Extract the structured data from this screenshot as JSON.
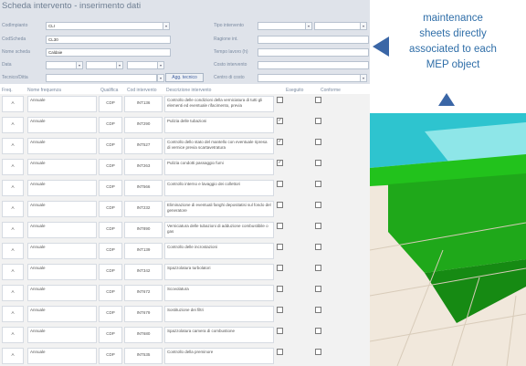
{
  "form": {
    "title": "Scheda intervento - inserimento dati",
    "fields_left": [
      {
        "label": "CodImpianto",
        "value": "CLI"
      },
      {
        "label": "CodScheda",
        "value": "CL30"
      },
      {
        "label": "Nome scheda",
        "value": "Caldaie"
      },
      {
        "label": "Data",
        "value": ""
      },
      {
        "label": "Tecnico/Ditta",
        "value": ""
      }
    ],
    "fields_right": [
      {
        "label": "Tipo intervento",
        "value": ""
      },
      {
        "label": "Ragione int.",
        "value": ""
      },
      {
        "label": "Tempo lavoro (h)",
        "value": ""
      },
      {
        "label": "Costo intervento",
        "value": ""
      },
      {
        "label": "Centro di costo",
        "value": ""
      }
    ],
    "agg_button": "Agg. tecnico",
    "columns": [
      "Freq.",
      "Nome frequenza",
      "Qualifica",
      "Cod intervento",
      "Descrizione intervento",
      "Eseguito",
      "Conforme"
    ],
    "rows": [
      {
        "freq": "A",
        "name": "Annuale",
        "qual": "CDP",
        "code": "INT136",
        "desc": "Controllo delle condizioni della verniciatura di tutti gli elementi ed eventuale rifacimento, previa",
        "done": false,
        "conf": false
      },
      {
        "freq": "A",
        "name": "Annuale",
        "qual": "CDP",
        "code": "INT290",
        "desc": "Pulizia delle tubazioni",
        "done": true,
        "conf": false
      },
      {
        "freq": "A",
        "name": "Annuale",
        "qual": "CDP",
        "code": "INT527",
        "desc": "Controllo dello stato del mantello con eventuale ripresa di vernice previa scartavetratura",
        "done": true,
        "conf": false
      },
      {
        "freq": "A",
        "name": "Annuale",
        "qual": "CDP",
        "code": "INT263",
        "desc": "Pulizia condotti passaggio fumi",
        "done": true,
        "conf": false
      },
      {
        "freq": "A",
        "name": "Annuale",
        "qual": "CDP",
        "code": "INT566",
        "desc": "Controllo interno e lavaggio dei collettori",
        "done": false,
        "conf": false
      },
      {
        "freq": "A",
        "name": "Annuale",
        "qual": "CDP",
        "code": "INT232",
        "desc": "Eliminazione di eventuali fanghi depositatisi sul fondo del generatore",
        "done": false,
        "conf": false
      },
      {
        "freq": "A",
        "name": "Annuale",
        "qual": "CDP",
        "code": "INT890",
        "desc": "Verniciatura delle tubazioni di adduzione combustibile o gas",
        "done": false,
        "conf": false
      },
      {
        "freq": "A",
        "name": "Annuale",
        "qual": "CDP",
        "code": "INT139",
        "desc": "Controllo delle incrostazioni",
        "done": false,
        "conf": false
      },
      {
        "freq": "A",
        "name": "Annuale",
        "qual": "CDP",
        "code": "INT342",
        "desc": "Spazzolatura turbolatori",
        "done": false,
        "conf": false
      },
      {
        "freq": "A",
        "name": "Annuale",
        "qual": "CDP",
        "code": "INT672",
        "desc": "Scovolatura",
        "done": false,
        "conf": false
      },
      {
        "freq": "A",
        "name": "Annuale",
        "qual": "CDP",
        "code": "INT679",
        "desc": "Sostituzione dei filtri",
        "done": false,
        "conf": false
      },
      {
        "freq": "A",
        "name": "Annuale",
        "qual": "CDP",
        "code": "INT680",
        "desc": "Spazzolatura camera di combustione",
        "done": false,
        "conf": false
      },
      {
        "freq": "A",
        "name": "Annuale",
        "qual": "CDP",
        "code": "INT535",
        "desc": "Controllo della preminore",
        "done": false,
        "conf": false
      }
    ]
  },
  "annotation": {
    "line1": "maintenance",
    "line2": "sheets directly",
    "line3": "associated to each",
    "line4": "MEP object"
  },
  "colors": {
    "accent": "#2f6ea8",
    "arrow": "#3a66a6",
    "object": "#22c21c",
    "header_bg": "#dfe3ea"
  },
  "icons": {
    "arrow_left": "triangle-left-icon",
    "arrow_up": "triangle-up-icon",
    "checkbox": "checkbox-icon",
    "dropdown": "chevron-down-icon"
  }
}
